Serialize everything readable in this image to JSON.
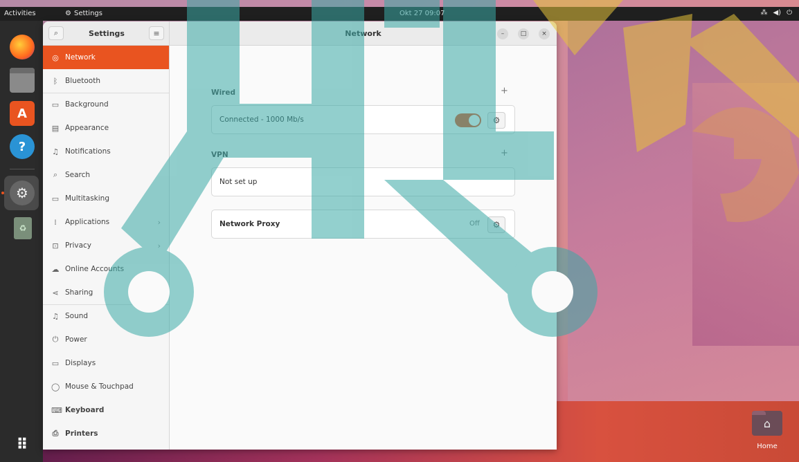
{
  "topbar": {
    "activities": "Activities",
    "app_name": "Settings",
    "clock": "Okt 27  09:07"
  },
  "dock": {
    "items": [
      "firefox-icon",
      "files-icon",
      "software-icon",
      "help-icon",
      "settings-icon",
      "trash-icon",
      "show-apps-icon"
    ]
  },
  "desktop": {
    "home_label": "Home"
  },
  "window": {
    "sidebar_title": "Settings",
    "main_title": "Network"
  },
  "sidebar": {
    "items": [
      {
        "label": "Network",
        "icon": "network-icon"
      },
      {
        "label": "Bluetooth",
        "icon": "bluetooth-icon"
      },
      {
        "label": "Background",
        "icon": "background-icon"
      },
      {
        "label": "Appearance",
        "icon": "appearance-icon"
      },
      {
        "label": "Notifications",
        "icon": "bell-icon"
      },
      {
        "label": "Search",
        "icon": "search-icon"
      },
      {
        "label": "Multitasking",
        "icon": "multitasking-icon"
      },
      {
        "label": "Applications",
        "icon": "apps-grid-icon"
      },
      {
        "label": "Privacy",
        "icon": "lock-icon"
      },
      {
        "label": "Online Accounts",
        "icon": "cloud-icon"
      },
      {
        "label": "Sharing",
        "icon": "share-icon"
      },
      {
        "label": "Sound",
        "icon": "music-note-icon"
      },
      {
        "label": "Power",
        "icon": "power-icon"
      },
      {
        "label": "Displays",
        "icon": "monitor-icon"
      },
      {
        "label": "Mouse & Touchpad",
        "icon": "mouse-icon"
      },
      {
        "label": "Keyboard",
        "icon": "keyboard-icon"
      },
      {
        "label": "Printers",
        "icon": "printer-icon"
      }
    ]
  },
  "network": {
    "wired_label": "Wired",
    "wired_status": "Connected - 1000 Mb/s",
    "wired_enabled": true,
    "vpn_label": "VPN",
    "vpn_status": "Not set up",
    "proxy_label": "Network Proxy",
    "proxy_status": "Off"
  },
  "colors": {
    "accent": "#e95420",
    "topbar": "#1f1f1f",
    "dock": "#2b2b2b",
    "watermark": "#3aa9a6"
  }
}
